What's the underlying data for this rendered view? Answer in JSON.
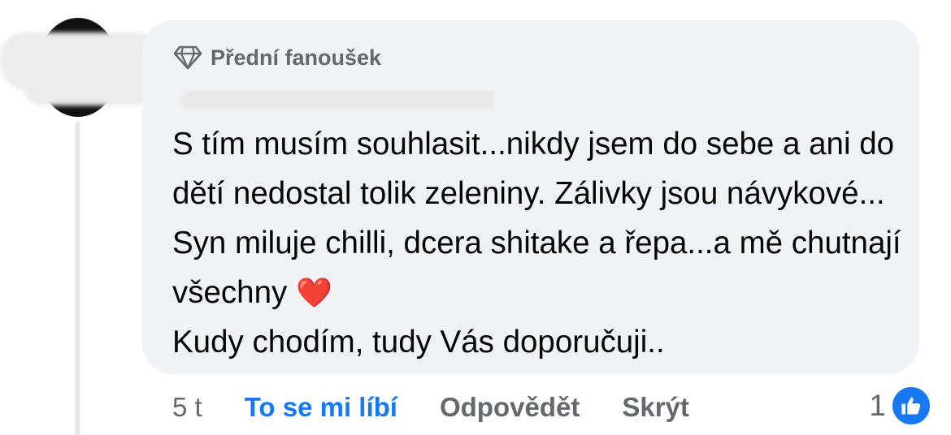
{
  "comment": {
    "badge_label": "Přední fanoušek",
    "author_name": "",
    "text": "S tím musím souhlasit...nikdy jsem do sebe a ani do dětí nedostal tolik zeleniny. Zálivky jsou návykové... Syn miluje chilli, dcera shitake a řepa...a mě chutnají všechny",
    "text_end": "Kudy chodím, tudy Vás doporučuji..",
    "heart_emoji": "❤️"
  },
  "actions": {
    "time": "5 t",
    "like_label": "To se mi líbí",
    "reply_label": "Odpovědět",
    "hide_label": "Skrýt"
  },
  "reactions": {
    "count": "1",
    "icon": "thumbs-up-icon"
  },
  "colors": {
    "accent": "#1877f2",
    "bubble": "#f0f2f5",
    "secondary_text": "#65676b"
  }
}
